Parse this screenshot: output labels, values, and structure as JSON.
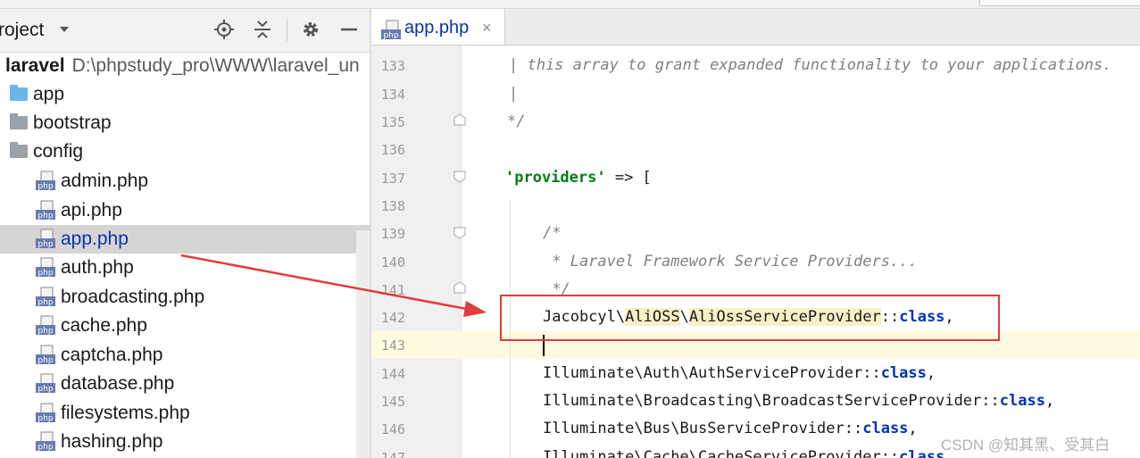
{
  "project_panel": {
    "title": "roject",
    "root": {
      "name": "laravel",
      "path": "D:\\phpstudy_pro\\WWW\\laravel_un"
    },
    "folders": [
      {
        "name": "app",
        "color": "#68b7e8"
      },
      {
        "name": "bootstrap",
        "color": "#9aa1a8"
      },
      {
        "name": "config",
        "color": "#9aa1a8"
      }
    ],
    "files": [
      "admin.php",
      "api.php",
      "app.php",
      "auth.php",
      "broadcasting.php",
      "cache.php",
      "captcha.php",
      "database.php",
      "filesystems.php",
      "hashing.php"
    ],
    "selected_file": "app.php",
    "header_icons": [
      "locate-icon",
      "collapse-all-icon",
      "gear-icon",
      "minimize-icon"
    ]
  },
  "editor": {
    "tab": {
      "label": "app.php",
      "close": "×",
      "icon_text": "php"
    },
    "lines": {
      "133": "133",
      "134": "134",
      "135": "135",
      "136": "136",
      "137": "137",
      "138": "138",
      "139": "139",
      "140": "140",
      "141": "141",
      "142": "142",
      "143": "143",
      "144": "144",
      "145": "145",
      "146": "146",
      "147": "147"
    },
    "code": {
      "l133": "| this array to grant expanded functionality to your applications.",
      "l134": "|",
      "l135": "*/",
      "l137_key": "'providers'",
      "l137_rest": " => [",
      "l139": "/*",
      "l140": " * Laravel Framework Service Providers...",
      "l141": " */",
      "l142_ns": "Jacobcyl",
      "l142_sep1": "\\",
      "l142_pkg": "AliOSS",
      "l142_sep2": "\\",
      "l142_cls": "AliOssServiceProvider",
      "l142_dc": "::",
      "l142_kw": "class",
      "l142_end": ",",
      "l144_a": "Illuminate\\Auth\\AuthServiceProvider::",
      "l145_a": "Illuminate\\Broadcasting\\BroadcastServiceProvider::",
      "l146_a": "Illuminate\\Bus\\BusServiceProvider::",
      "l147_a": "Illuminate\\Cache\\CacheServiceProvider::",
      "kw_class": "class",
      "comma": ","
    }
  },
  "watermark": "CSDN @知其黑、受其白",
  "colors": {
    "accent": "#0b33a8",
    "annotation": "#e23b3b",
    "current_line": "#fffbe0"
  }
}
